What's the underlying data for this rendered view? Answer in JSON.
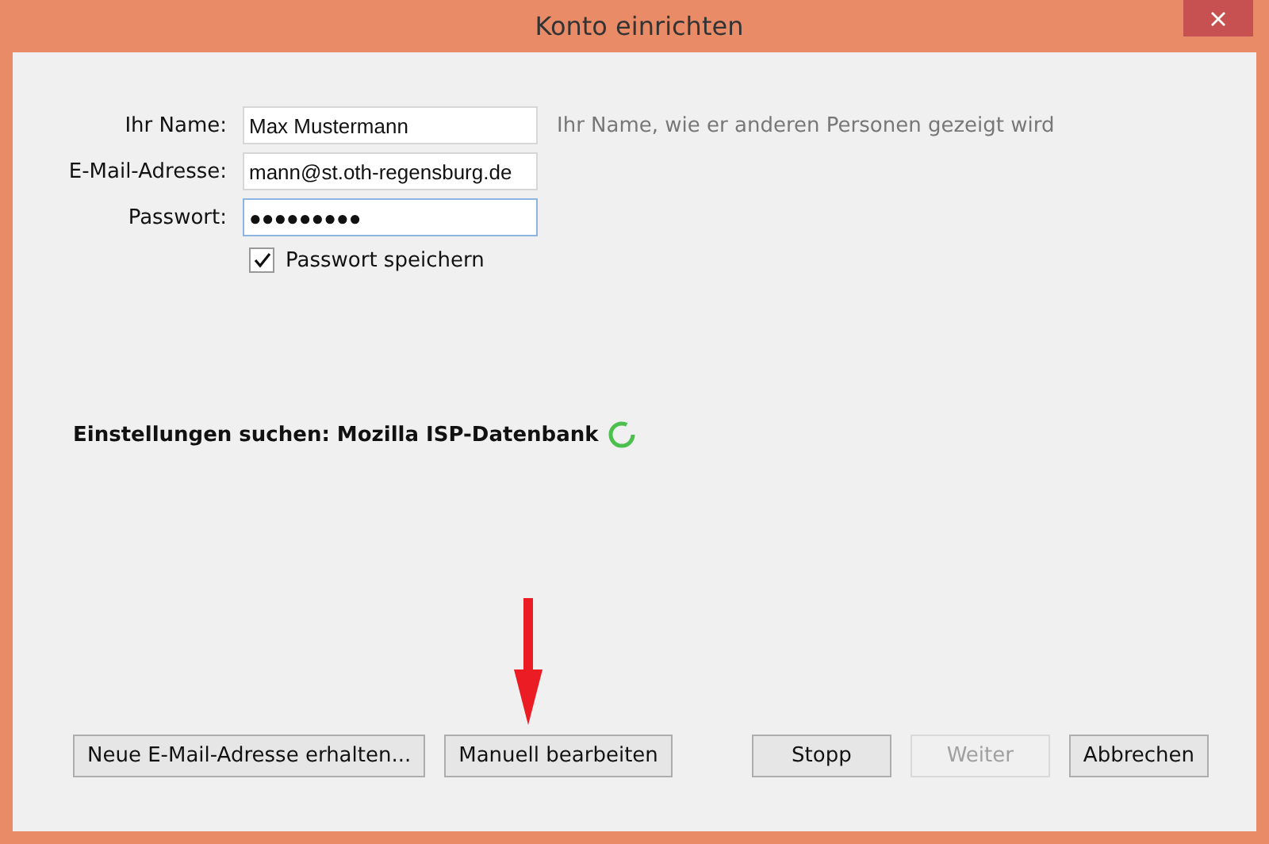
{
  "window": {
    "title": "Konto einrichten"
  },
  "fields": [
    {
      "label": "Ihr Name:",
      "value": "Max Mustermann",
      "hint": "Ihr Name, wie er anderen Personen gezeigt wird",
      "focused": false
    },
    {
      "label": "E-Mail-Adresse:",
      "value": "mann@st.oth-regensburg.de",
      "focused": false
    },
    {
      "label": "Passwort:",
      "value": "●●●●●●●●●",
      "focused": true
    }
  ],
  "remember_password": {
    "label": "Passwort speichern",
    "checked": true
  },
  "status": {
    "text": "Einstellungen suchen: Mozilla ISP-Datenbank",
    "busy": true
  },
  "buttons_left": [
    {
      "label": "Neue E-Mail-Adresse erhalten...",
      "disabled": false
    },
    {
      "label": "Manuell bearbeiten",
      "disabled": false
    }
  ],
  "buttons_right": [
    {
      "label": "Stopp",
      "disabled": false
    },
    {
      "label": "Weiter",
      "disabled": true
    },
    {
      "label": "Abbrechen",
      "disabled": false
    }
  ]
}
